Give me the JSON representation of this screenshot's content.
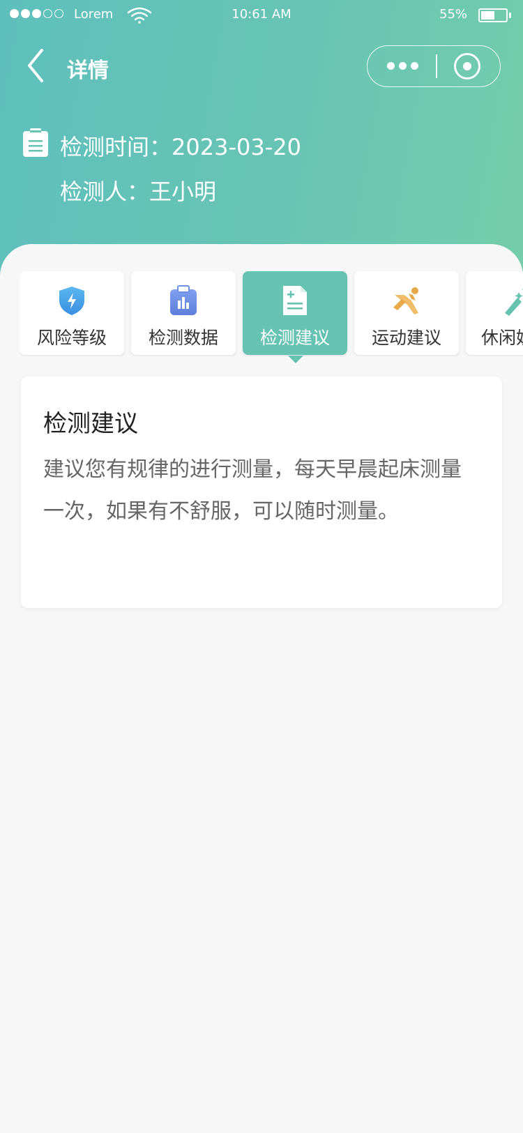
{
  "status_bar": {
    "carrier": "Lorem",
    "time": "10:61 AM",
    "battery_percent": "55%",
    "battery_level": 0.55,
    "signal_bars_filled": 3,
    "signal_bars_total": 5
  },
  "nav": {
    "title": "详情",
    "back_icon": "chevron-left-icon",
    "more_icon": "more-dots-icon",
    "close_icon": "target-circle-icon"
  },
  "info": {
    "detect_time": "检测时间：2023-03-20",
    "detect_person": "检测人：王小明"
  },
  "tabs": [
    {
      "label": "风险等级",
      "icon": "shield-bolt-icon",
      "color": "#4aa3e8"
    },
    {
      "label": "检测数据",
      "icon": "clipboard-chart-icon",
      "color": "#6d8fe3"
    },
    {
      "label": "检测建议",
      "icon": "document-plus-icon",
      "color": "#ffffff",
      "active": true
    },
    {
      "label": "运动建议",
      "icon": "runner-icon",
      "color": "#e8b15a"
    },
    {
      "label": "休闲娱",
      "icon": "sparkle-wand-icon",
      "color": "#66c2b1"
    }
  ],
  "card": {
    "title": "检测建议",
    "body": "建议您有规律的进行测量，每天早晨起床测量一次，如果有不舒服，可以随时测量。"
  },
  "colors": {
    "accent": "#66c2b1",
    "header_start": "#5fbfbd",
    "header_end": "#73cdab"
  }
}
